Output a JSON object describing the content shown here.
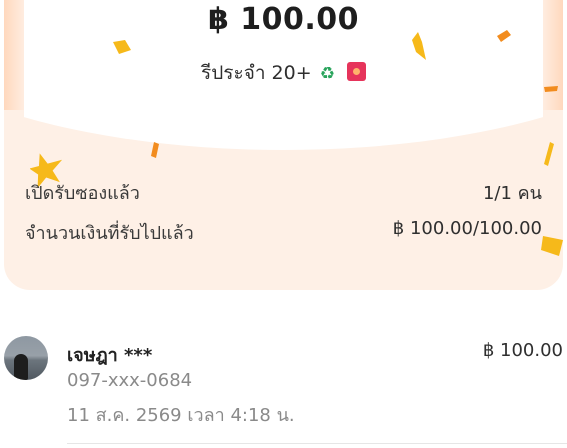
{
  "envelope": {
    "amount": "฿ 100.00",
    "campaign_name": "รีประจำ 20+",
    "campaign_icons": [
      "recycle-icon",
      "red-envelope-icon"
    ]
  },
  "stats": {
    "opened_label": "เปิดรับซองแล้ว",
    "opened_value": "1/1 คน",
    "received_label": "จำนวนเงินที่รับไปแล้ว",
    "received_value": "฿ 100.00/100.00"
  },
  "claimers": [
    {
      "name": "เจษฎา ***",
      "amount": "฿ 100.00",
      "phone": "097-xxx-0684",
      "time": "11 ส.ค. 2569 เวลา 4:18 น."
    }
  ],
  "colors": {
    "card_background": "#fef0e6",
    "confetti_gold": "#f6b91a",
    "confetti_orange": "#f28c1e",
    "envelope_red": "#e6345b"
  }
}
